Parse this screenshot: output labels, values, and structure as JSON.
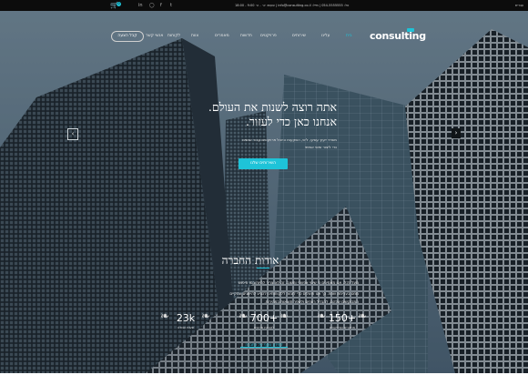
{
  "topbar": {
    "lang": "עברית",
    "contact": "טל: 054-5555555  |  מייל: info@consulting.co.il  |  שעות: א׳ - ה׳ 9:00 - 18:00",
    "cart_count": "0",
    "social_icons": [
      "linkedin-icon",
      "instagram-icon",
      "facebook-icon",
      "twitter-icon"
    ]
  },
  "nav": {
    "logo": "consulting",
    "items": [
      "בית",
      "עלינו",
      "שירותים",
      "פרויקטים",
      "חדשות",
      "מאמרים",
      "צוות",
      "לקוחות",
      "אנשי קשר"
    ],
    "active_index": 0,
    "quote_label": "קבל הצעה"
  },
  "hero": {
    "headline_line1": "אתה רוצה לשנות את העולם.",
    "headline_line2": "אנחנו כאן כדי לעזור.",
    "sub_line1": "משרד ייעוץ עסקי, ליווי, השקעות וניהול פרויקטים עבור אנשים",
    "sub_line2": "כדי ליצור שינוי אמיתי",
    "cta_label": "השירותים שלנו",
    "prev_icon": "chevron-left-icon",
    "next_icon": "chevron-right-icon"
  },
  "about": {
    "title": "אודות החברה",
    "line1": "מעל לכל, אנו מאמינים כי שינוי אפשרי וחשוב. זה לא צריך להיות כמו חיפוש",
    "line2": "מחט בערימת שחת. כך אנו פועלים כדי לעזור ללקוחותינו להגיע להישגים עסקיים",
    "line3": "המבוקשים שלהם, להגדיל רווחים ולשפר תוצאות במהירות.",
    "stats": [
      {
        "num": "150+",
        "label": "מחקרים ופרויקטים"
      },
      {
        "num": "700+",
        "label": "לקוחות מרוצים"
      },
      {
        "num": "23k",
        "label": "שעות עבודה"
      }
    ],
    "more_link": "למידע נוסף על החברה"
  },
  "colors": {
    "accent": "#1ec3d8",
    "topbar": "#0c0c0c"
  }
}
